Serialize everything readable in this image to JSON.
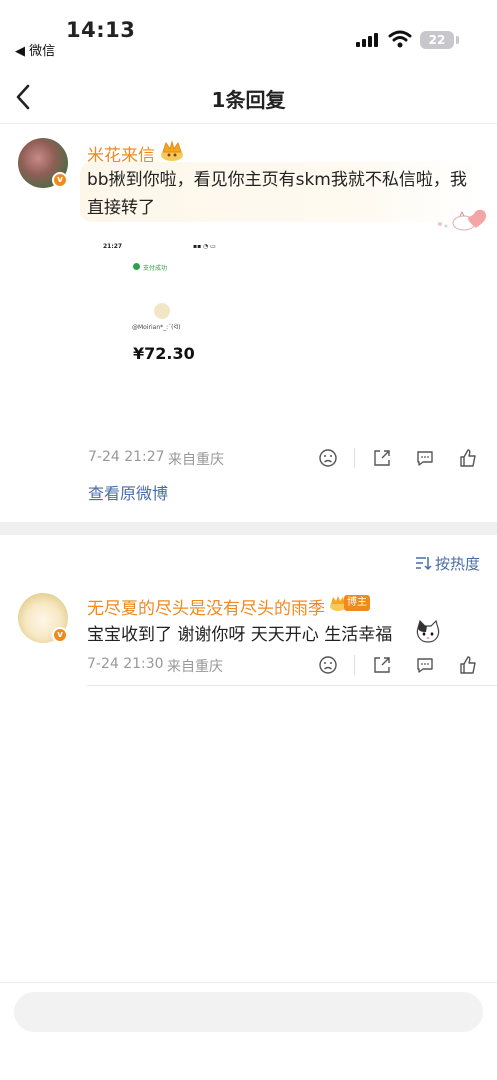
{
  "status_bar": {
    "time": "14:13",
    "back_app": "◀ 微信",
    "battery": "22"
  },
  "nav": {
    "title": "1条回复"
  },
  "comment": {
    "username": "米花来信",
    "text": "bb揪到你啦，看见你主页有skm我就不私信啦，我直接转了",
    "image": {
      "time": "21:27",
      "status": "支付成功",
      "payee": "@Moirian*_:´(ᐛ)",
      "amount": "¥72.30"
    },
    "timestamp": "7-24 21:27",
    "location": "来自重庆",
    "view_original": "查看原微博"
  },
  "sort": {
    "label": "按热度"
  },
  "reply": {
    "username": "无尽夏的尽头是没有尽头的雨季",
    "badge": "博主",
    "text": "宝宝收到了 谢谢你呀 天天开心 生活幸福",
    "timestamp": "7-24 21:30",
    "location": "来自重庆"
  },
  "bottom": {
    "input_placeholder": ""
  },
  "colors": {
    "accent": "#f08a1d",
    "link": "#4a6da7",
    "meta": "#999999"
  }
}
